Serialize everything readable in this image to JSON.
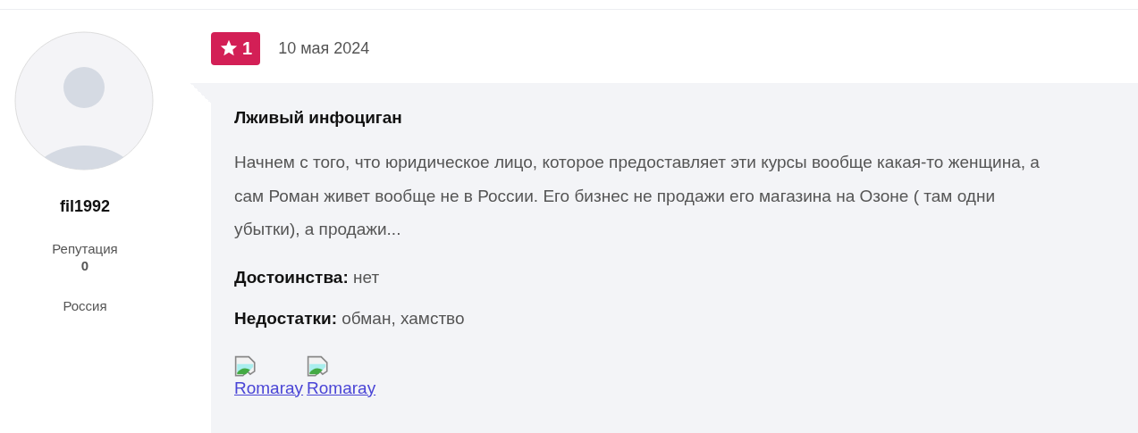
{
  "author": {
    "username": "fil1992",
    "reputation_label": "Репутация",
    "reputation": "0",
    "country": "Россия"
  },
  "review": {
    "rating": "1",
    "date": "10 мая 2024",
    "title": "Лживый инфоциган",
    "text": "Начнем с того, что юридическое лицо, которое предоставляет эти курсы вообще какая-то женщина, а сам Роман живет вообще не в России. Его бизнес не продажи его магазина на Озоне ( там одни убытки), а продажи...",
    "pros_label": "Достоинства:",
    "pros": "нет",
    "cons_label": "Недостатки:",
    "cons": "обман, хамство",
    "images": [
      {
        "alt": "Romaray"
      },
      {
        "alt": "Romaray"
      }
    ]
  }
}
